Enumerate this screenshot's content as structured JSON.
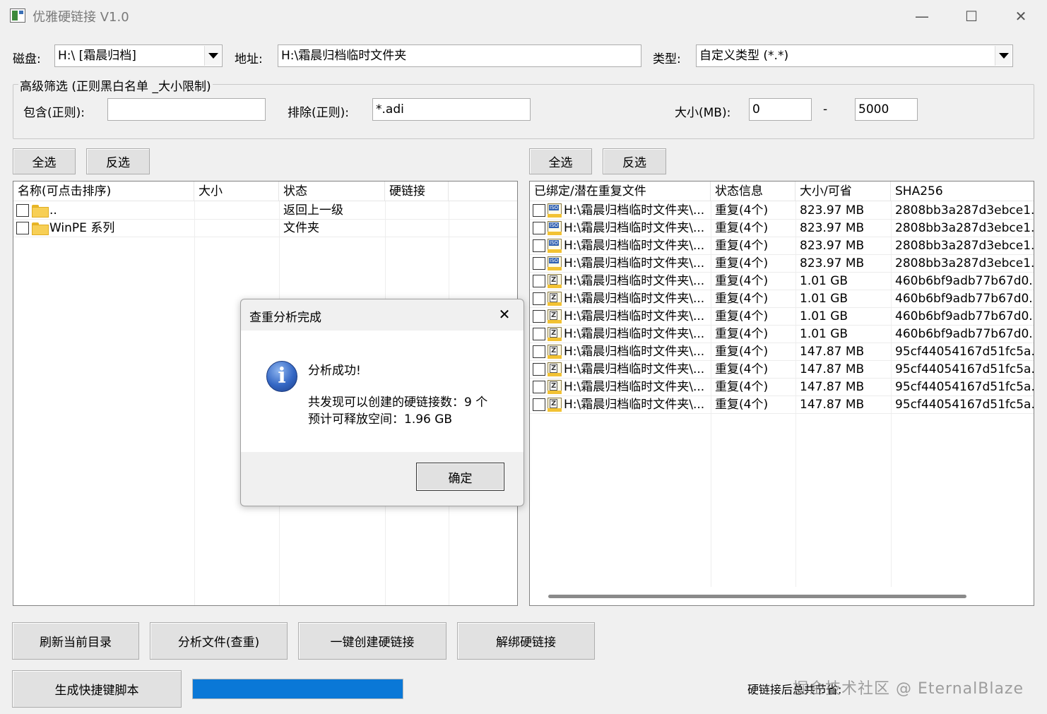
{
  "window": {
    "title": "优雅硬链接 V1.0",
    "minimize": "—",
    "maximize": "☐",
    "close": "✕"
  },
  "toolbar": {
    "disk_label": "磁盘:",
    "disk_value": "H:\\ [霜晨归档]",
    "path_label": "地址:",
    "path_value": "H:\\霜晨归档临时文件夹",
    "type_label": "类型:",
    "type_value": "自定义类型 (*.*)"
  },
  "filter": {
    "group_title": "高级筛选 (正则黑白名单 _大小限制)",
    "include_label": "包含(正则):",
    "include_value": "",
    "exclude_label": "排除(正则):",
    "exclude_value": "*.adi",
    "size_label": "大小(MB):",
    "size_min": "0",
    "size_sep": "-",
    "size_max": "5000"
  },
  "left_panel": {
    "select_all": "全选",
    "invert": "反选",
    "columns": [
      "名称(可点击排序)",
      "大小",
      "状态",
      "硬链接"
    ],
    "rows": [
      {
        "name": "..",
        "size": "",
        "status": "返回上一级",
        "link": ""
      },
      {
        "name": "WinPE 系列",
        "size": "",
        "status": "文件夹",
        "link": ""
      }
    ]
  },
  "right_panel": {
    "select_all": "全选",
    "invert": "反选",
    "columns": [
      "已绑定/潜在重复文件",
      "状态信息",
      "大小/可省",
      "SHA256"
    ],
    "rows": [
      {
        "icon": "iso",
        "path": "H:\\霜晨归档临时文件夹\\...",
        "status": "重复(4个)",
        "size": "823.97 MB",
        "sha": "2808bb3a287d3ebce1..."
      },
      {
        "icon": "iso",
        "path": "H:\\霜晨归档临时文件夹\\...",
        "status": "重复(4个)",
        "size": "823.97 MB",
        "sha": "2808bb3a287d3ebce1..."
      },
      {
        "icon": "iso",
        "path": "H:\\霜晨归档临时文件夹\\...",
        "status": "重复(4个)",
        "size": "823.97 MB",
        "sha": "2808bb3a287d3ebce1..."
      },
      {
        "icon": "iso",
        "path": "H:\\霜晨归档临时文件夹\\...",
        "status": "重复(4个)",
        "size": "823.97 MB",
        "sha": "2808bb3a287d3ebce1..."
      },
      {
        "icon": "zip",
        "path": "H:\\霜晨归档临时文件夹\\...",
        "status": "重复(4个)",
        "size": "1.01 GB",
        "sha": "460b6bf9adb77b67d0..."
      },
      {
        "icon": "zip",
        "path": "H:\\霜晨归档临时文件夹\\...",
        "status": "重复(4个)",
        "size": "1.01 GB",
        "sha": "460b6bf9adb77b67d0..."
      },
      {
        "icon": "zip",
        "path": "H:\\霜晨归档临时文件夹\\...",
        "status": "重复(4个)",
        "size": "1.01 GB",
        "sha": "460b6bf9adb77b67d0..."
      },
      {
        "icon": "zip",
        "path": "H:\\霜晨归档临时文件夹\\...",
        "status": "重复(4个)",
        "size": "1.01 GB",
        "sha": "460b6bf9adb77b67d0..."
      },
      {
        "icon": "zip",
        "path": "H:\\霜晨归档临时文件夹\\...",
        "status": "重复(4个)",
        "size": "147.87 MB",
        "sha": "95cf44054167d51fc5a..."
      },
      {
        "icon": "zip",
        "path": "H:\\霜晨归档临时文件夹\\...",
        "status": "重复(4个)",
        "size": "147.87 MB",
        "sha": "95cf44054167d51fc5a..."
      },
      {
        "icon": "zip",
        "path": "H:\\霜晨归档临时文件夹\\...",
        "status": "重复(4个)",
        "size": "147.87 MB",
        "sha": "95cf44054167d51fc5a..."
      },
      {
        "icon": "zip",
        "path": "H:\\霜晨归档临时文件夹\\...",
        "status": "重复(4个)",
        "size": "147.87 MB",
        "sha": "95cf44054167d51fc5a..."
      }
    ]
  },
  "dialog": {
    "title": "查重分析完成",
    "close": "✕",
    "icon_glyph": "i",
    "line1": "分析成功!",
    "line2": "共发现可以创建的硬链接数：9 个",
    "line3": "预计可释放空间：1.96 GB",
    "ok": "确定"
  },
  "actions": {
    "refresh": "刷新当前目录",
    "analyze": "分析文件(查重)",
    "create": "一键创建硬链接",
    "unbind": "解绑硬链接",
    "script": "生成快捷键脚本"
  },
  "status": {
    "progress_fraction": 0.999,
    "text": "硬链接后总共节省:",
    "watermark": "掘金技术社区 @ EternalBlaze",
    "colors": {
      "progress": "#0a78d7"
    }
  }
}
